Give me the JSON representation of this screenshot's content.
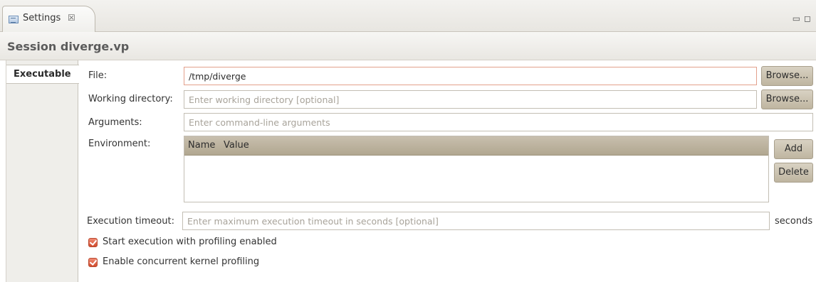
{
  "tab": {
    "label": "Settings",
    "close_glyph": "☒",
    "icon": "settings-view-icon"
  },
  "window_controls": {
    "minimize": "▭",
    "maximize": "◻"
  },
  "header": {
    "title": "Session diverge.vp"
  },
  "sidebar": {
    "tabs": [
      {
        "label": "Executable",
        "selected": true
      }
    ]
  },
  "form": {
    "file": {
      "label": "File:",
      "value": "/tmp/diverge",
      "browse_label": "Browse..."
    },
    "working_directory": {
      "label": "Working directory:",
      "placeholder": "Enter working directory [optional]",
      "browse_label": "Browse..."
    },
    "arguments": {
      "label": "Arguments:",
      "placeholder": "Enter command-line arguments"
    },
    "environment": {
      "label": "Environment:",
      "columns": [
        "Name",
        "Value"
      ],
      "rows": [],
      "add_label": "Add",
      "delete_label": "Delete"
    },
    "execution_timeout": {
      "label": "Execution timeout:",
      "placeholder": "Enter maximum execution timeout in seconds [optional]",
      "unit": "seconds"
    },
    "checkboxes": [
      {
        "label": "Start execution with profiling enabled",
        "checked": true
      },
      {
        "label": "Enable concurrent kernel profiling",
        "checked": true
      }
    ]
  },
  "colors": {
    "accent_checkbox": "#d9553a",
    "button_bg": "#c9c0ad",
    "table_header_bg": "#bdb39e"
  }
}
